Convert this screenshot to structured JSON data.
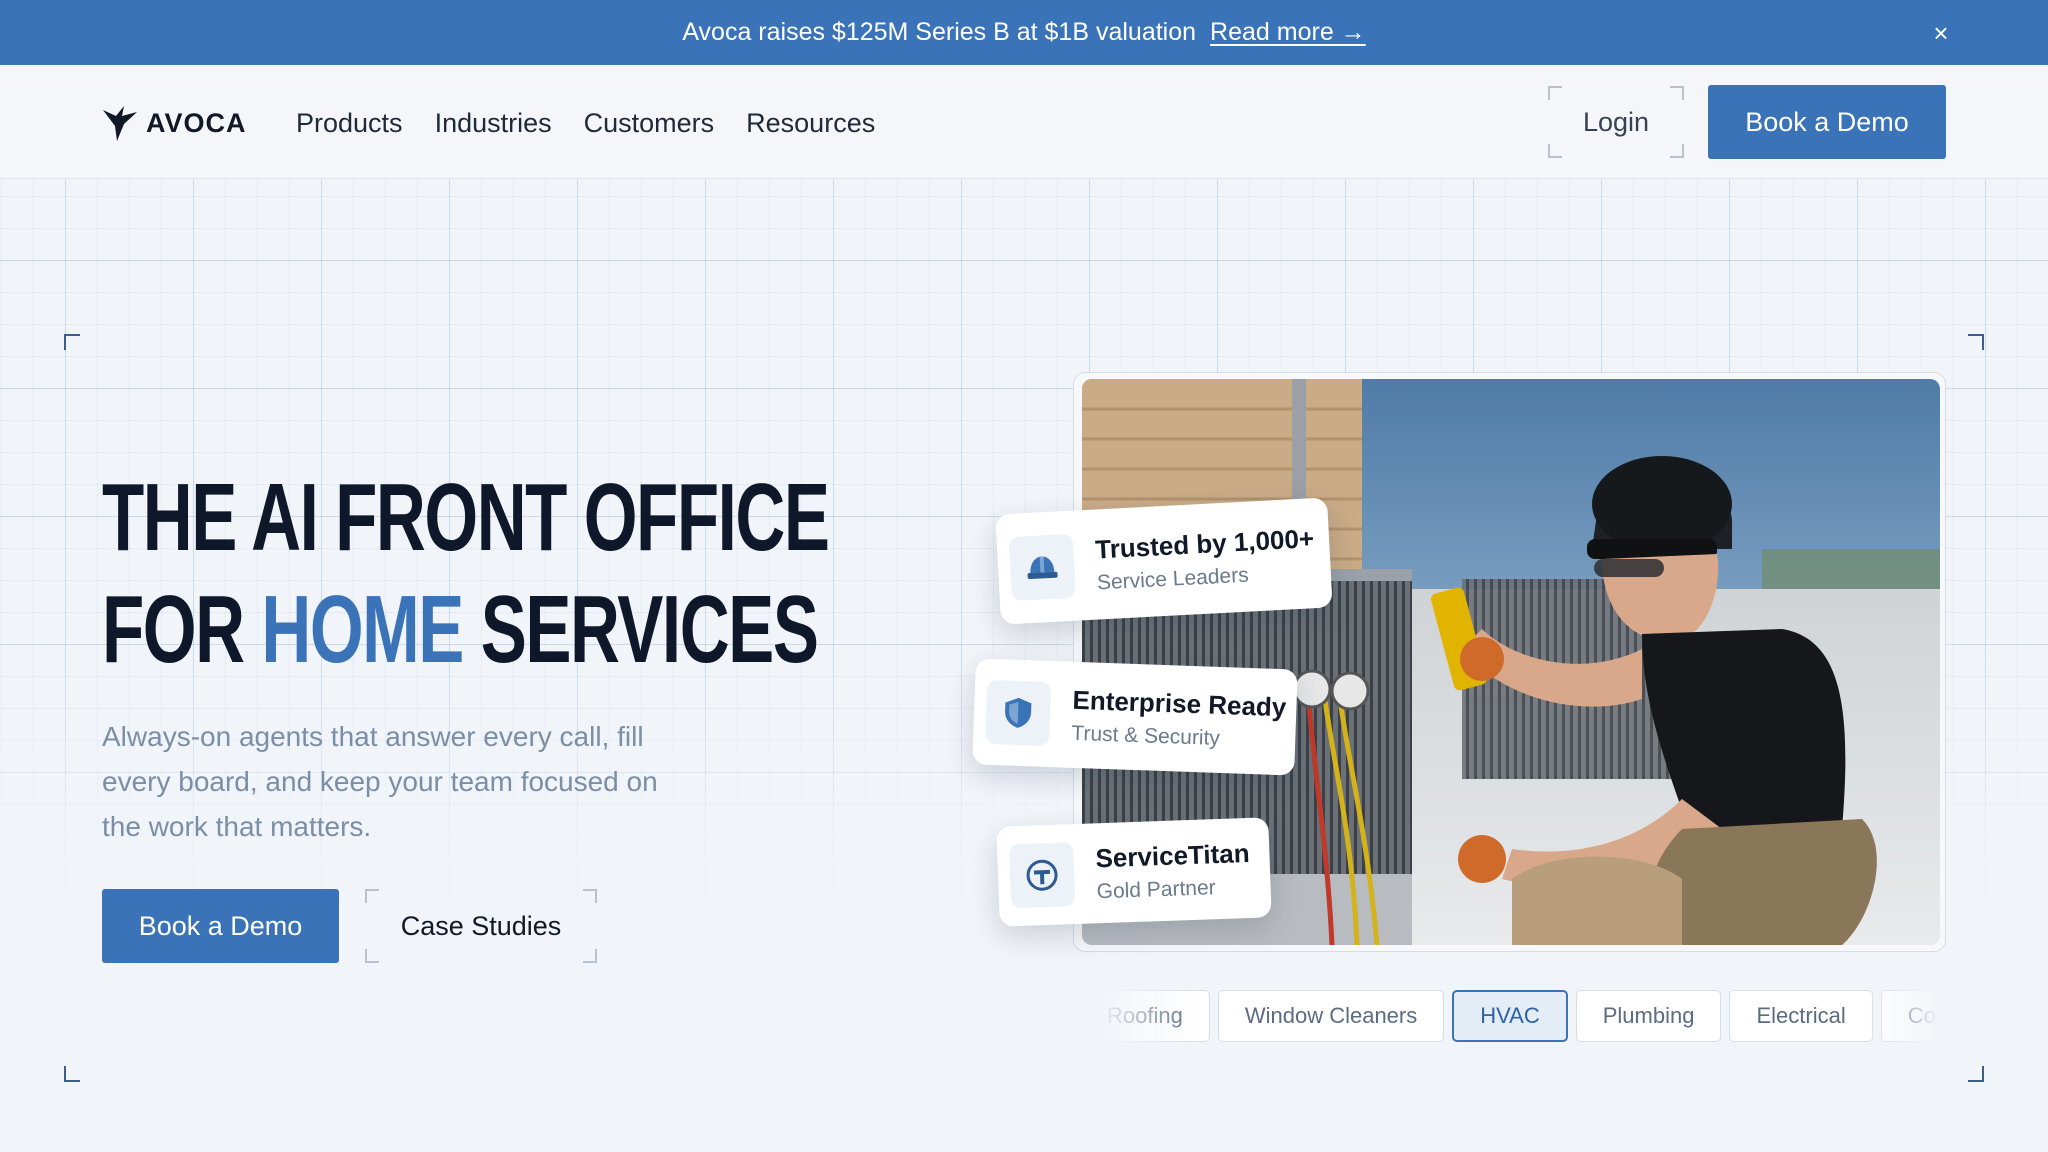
{
  "announcement": {
    "text": "Avoca raises $125M Series B at $1B valuation",
    "link": "Read more →",
    "close": "×"
  },
  "header": {
    "logo_text": "AVOCA",
    "nav": [
      "Products",
      "Industries",
      "Customers",
      "Resources"
    ],
    "login": "Login",
    "cta": "Book a Demo"
  },
  "hero": {
    "headline_line1": "THE AI FRONT OFFICE",
    "headline_line2_pre": "FOR ",
    "headline_line2_accent": "HOME",
    "headline_line2_post": " SERVICES",
    "subhead": "Always-on agents that answer every call, fill every board, and keep your team focused on the work that matters.",
    "primary_cta": "Book a Demo",
    "secondary_cta": "Case Studies"
  },
  "cards": [
    {
      "title": "Trusted by 1,000+",
      "subtitle": "Service Leaders",
      "icon": "hard-hat-icon"
    },
    {
      "title": "Enterprise Ready",
      "subtitle": "Trust & Security",
      "icon": "shield-icon"
    },
    {
      "title": "ServiceTitan",
      "subtitle": "Gold Partner",
      "icon": "servicetitan-logo-icon"
    }
  ],
  "industries": [
    "Roofing",
    "Window Cleaners",
    "HVAC",
    "Plumbing",
    "Electrical",
    "Co"
  ],
  "active_industry": "HVAC",
  "colors": {
    "brand": "#3a73b8",
    "headline": "#0f172a",
    "subhead": "#7a8ea7",
    "background": "#f1f4f8"
  }
}
